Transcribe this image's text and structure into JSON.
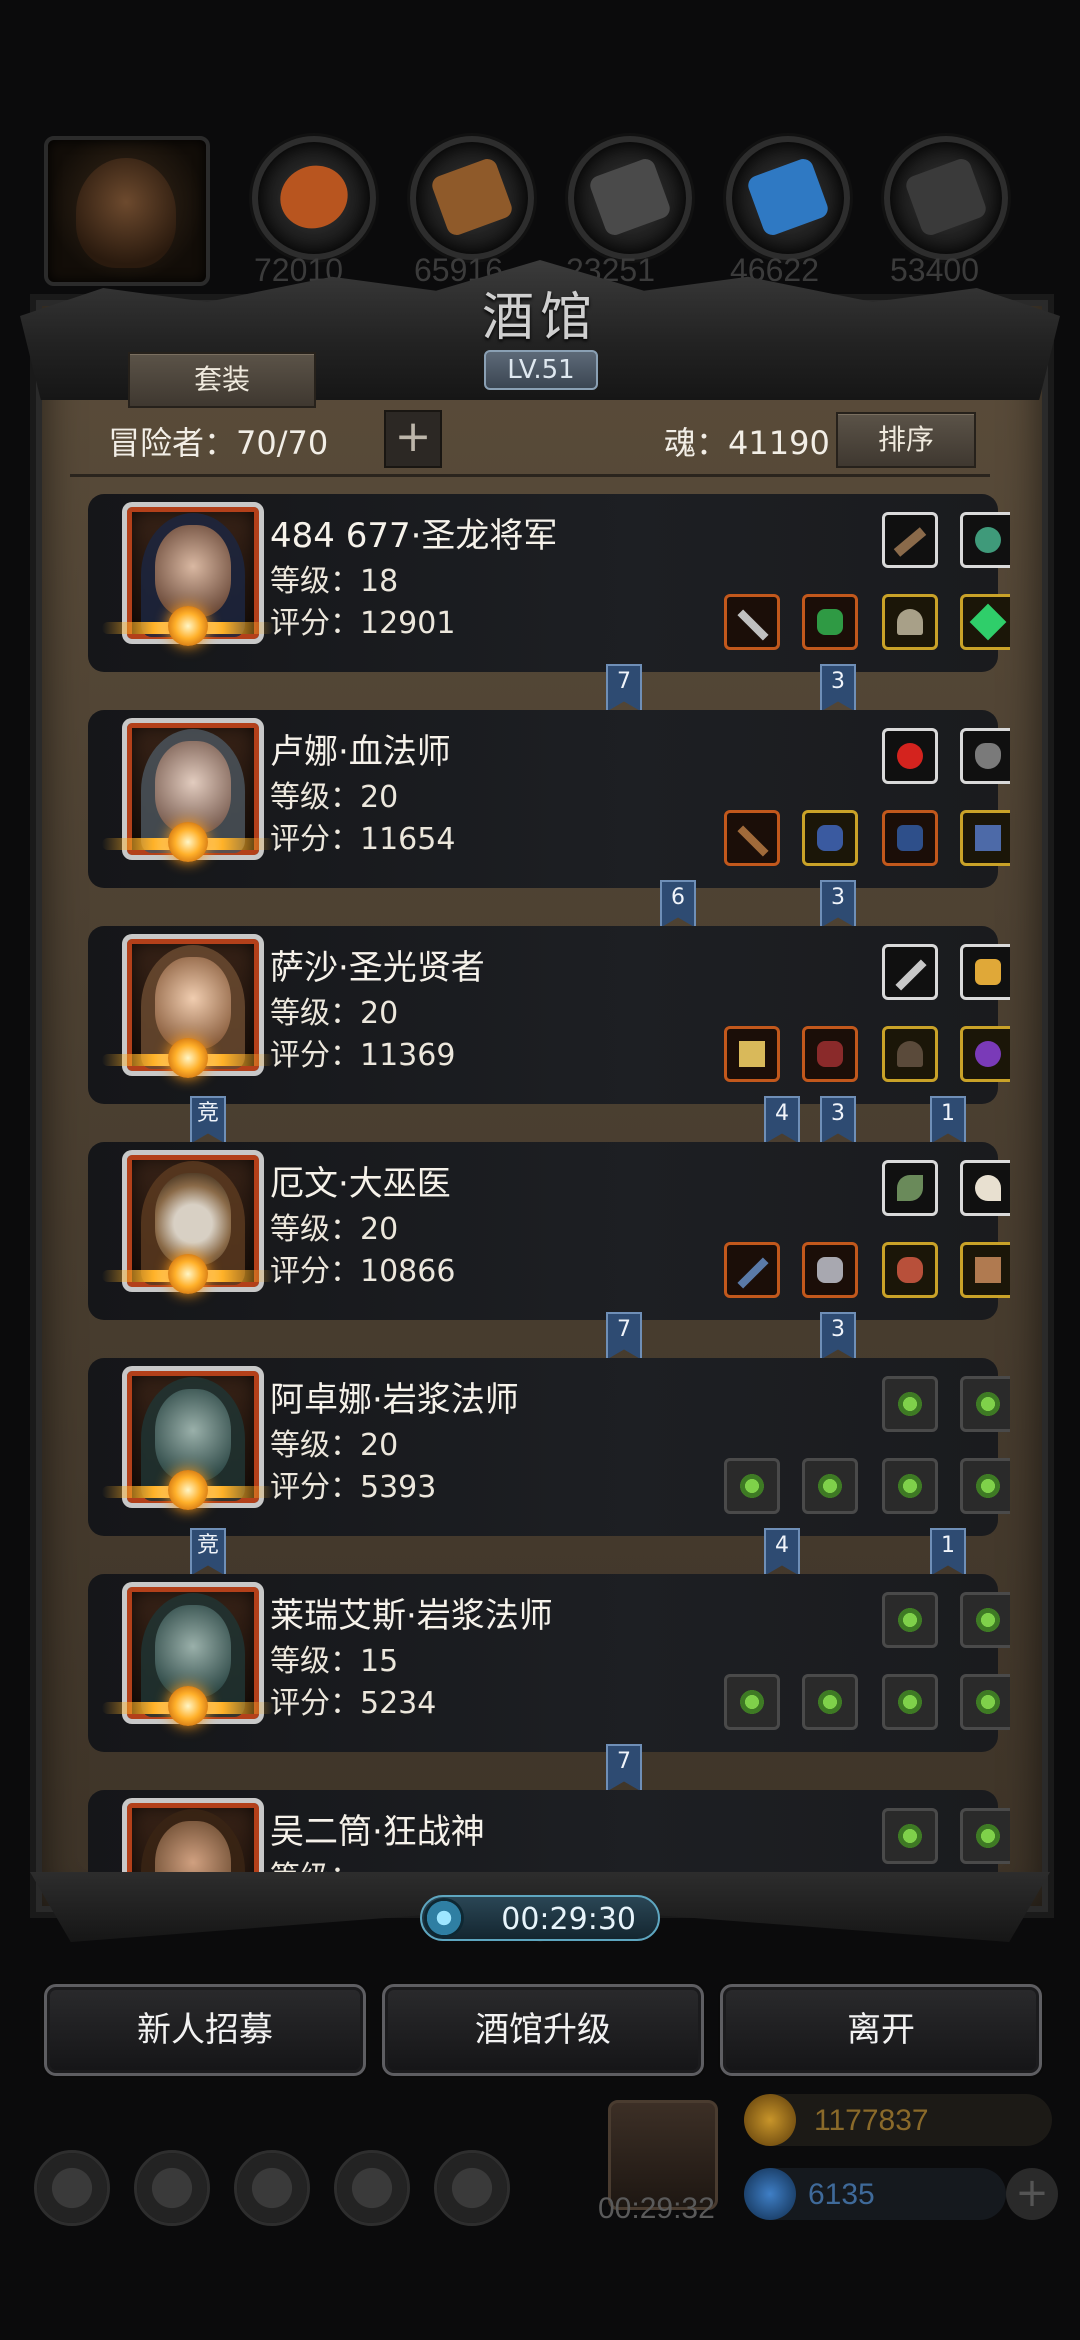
{
  "top_resources": [
    {
      "name": "food",
      "value": "72010",
      "color": "#b8551f"
    },
    {
      "name": "wood",
      "value": "65916",
      "color": "#8f5a2a"
    },
    {
      "name": "iron",
      "value": "23251",
      "color": "#4a4a4a"
    },
    {
      "name": "crystal",
      "value": "46622",
      "color": "#2f79c3"
    },
    {
      "name": "stone",
      "value": "53400",
      "color": "#3a3a3a"
    }
  ],
  "panel": {
    "title": "酒馆",
    "level": "LV.51",
    "set_button": "套装",
    "adventurers_label": "冒险者：70/70",
    "add_icon": "+",
    "soul_label": "魂：41190",
    "sort_button": "排序"
  },
  "heroes": [
    {
      "name": "484 677·圣龙将军",
      "level": "等级：18",
      "score": "评分：12901",
      "portrait_color": "#2b3a6b",
      "flags": [
        {
          "text": "7",
          "pos": "a"
        },
        {
          "text": "3",
          "pos": "c"
        }
      ]
    },
    {
      "name": "卢娜·血法师",
      "level": "等级：20",
      "score": "评分：11654",
      "portrait_color": "#56606a",
      "flags": [
        {
          "text": "6",
          "pos": "b"
        },
        {
          "text": "3",
          "pos": "c"
        }
      ]
    },
    {
      "name": "萨沙·圣光贤者",
      "level": "等级：20",
      "score": "评分：11369",
      "portrait_color": "#7a5a3a",
      "flags": [
        {
          "text": "竞",
          "pos": "l"
        },
        {
          "text": "4",
          "pos": "d"
        },
        {
          "text": "3",
          "pos": "c"
        },
        {
          "text": "1",
          "pos": "r"
        }
      ]
    },
    {
      "name": "厄文·大巫医",
      "level": "等级：20",
      "score": "评分：10866",
      "portrait_color": "#8a6a48",
      "flags": [
        {
          "text": "7",
          "pos": "a"
        },
        {
          "text": "3",
          "pos": "c"
        }
      ]
    },
    {
      "name": "阿卓娜·岩浆法师",
      "level": "等级：20",
      "score": "评分：5393",
      "portrait_color": "#2f4a48",
      "flags": [
        {
          "text": "竞",
          "pos": "l"
        },
        {
          "text": "4",
          "pos": "d"
        },
        {
          "text": "1",
          "pos": "r"
        }
      ]
    },
    {
      "name": "莱瑞艾斯·岩浆法师",
      "level": "等级：15",
      "score": "评分：5234",
      "portrait_color": "#2f4a48",
      "flags": [
        {
          "text": "7",
          "pos": "a"
        }
      ]
    },
    {
      "name": "吴二筒·狂战神",
      "level": "等级：",
      "score": "",
      "portrait_color": "#6a4a30",
      "flags": []
    }
  ],
  "timer": "00:29:30",
  "buttons": {
    "recruit": "新人招募",
    "upgrade": "酒馆升级",
    "leave": "离开"
  },
  "bottom": {
    "gift_timer": "00:29:32",
    "gold": "1177837",
    "gems": "6135",
    "gold_color": "#c8952a",
    "gem_color": "#3f7fc6"
  }
}
